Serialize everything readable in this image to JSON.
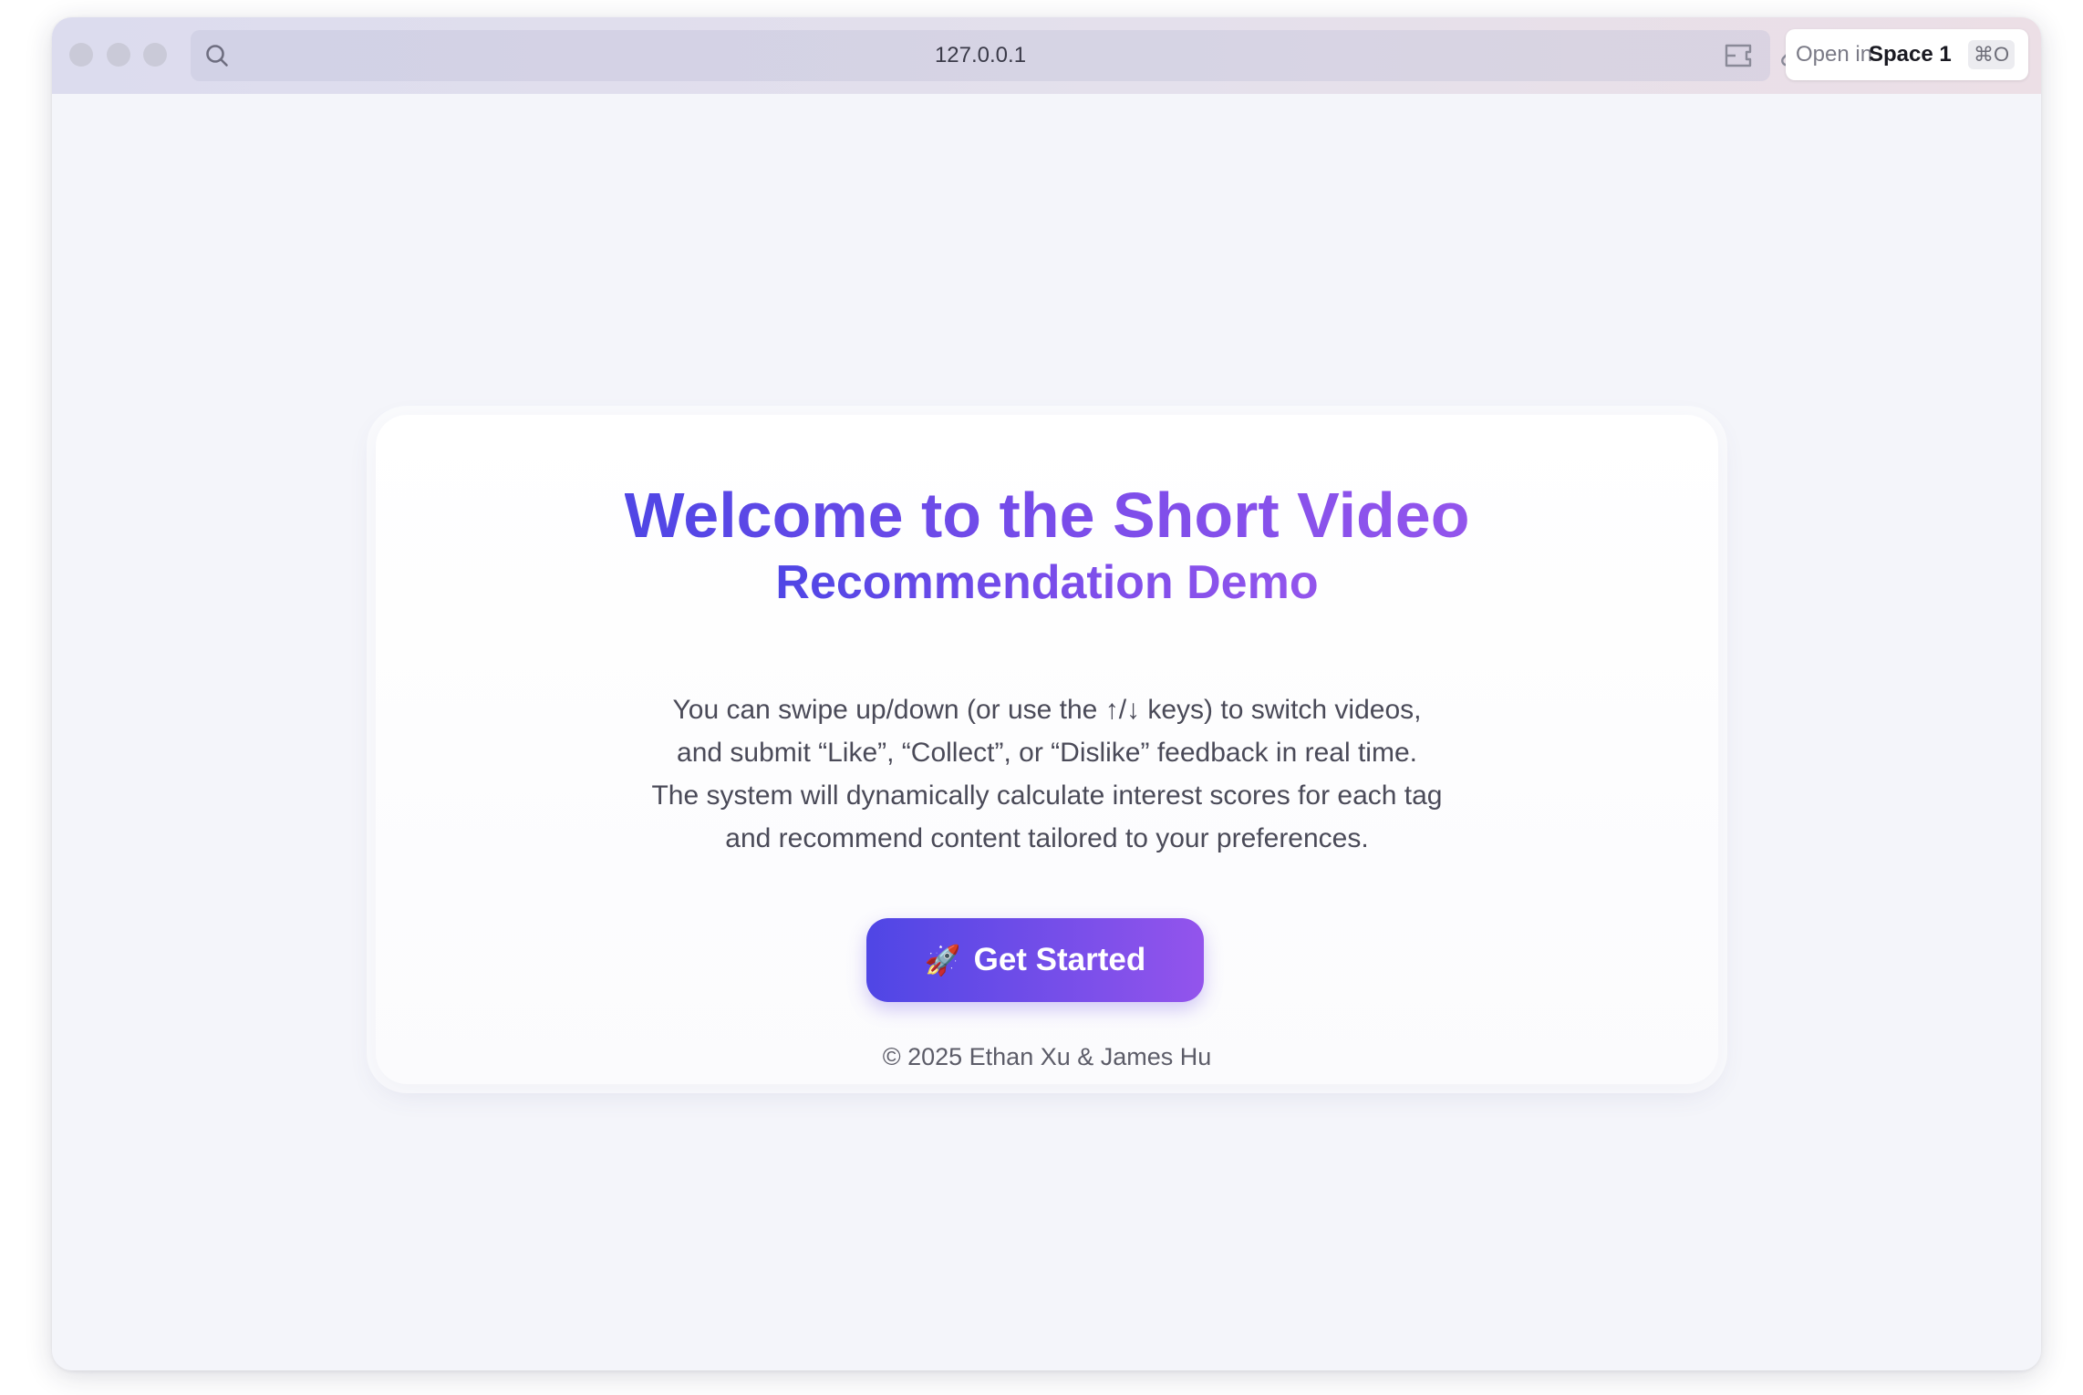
{
  "browser": {
    "url": "127.0.0.1",
    "open_in_prefix": "Open in",
    "open_in_space": "Space 1",
    "shortcut": "⌘O"
  },
  "card": {
    "title_line1": "Welcome to the Short Video",
    "title_line2": "Recommendation Demo",
    "description": [
      "You can swipe up/down (or use the ↑/↓ keys) to switch videos,",
      "and submit “Like”, “Collect”, or “Dislike” feedback in real time.",
      "The system will dynamically calculate interest scores for each tag",
      "and recommend content tailored to your preferences."
    ],
    "button_icon": "🚀",
    "button_label": "Get Started",
    "copyright": "© 2025 Ethan Xu & James Hu"
  },
  "icons": {
    "search": "search-icon",
    "extension": "extension-icon",
    "link": "link-icon",
    "rocket": "rocket-icon"
  },
  "colors": {
    "accent_start": "#4f46e5",
    "accent_end": "#9354ec",
    "page_background": "#f4f5fa"
  }
}
